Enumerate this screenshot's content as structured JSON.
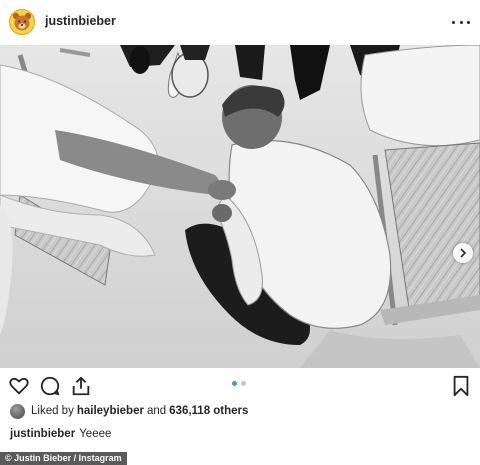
{
  "post": {
    "username": "justinbieber",
    "avatar_icon": "bear-avatar-icon"
  },
  "photo": {
    "description_icon": "photo"
  },
  "actions": {
    "like_icon": "heart-icon",
    "comment_icon": "comment-icon",
    "share_icon": "share-icon",
    "save_icon": "bookmark-icon",
    "carousel_count": 2,
    "carousel_active": 1
  },
  "likes": {
    "prefix": "Liked by",
    "user": "haileybieber",
    "connector": "and",
    "count_text": "636,118 others"
  },
  "caption": {
    "username": "justinbieber",
    "text": "Yeeee"
  },
  "credit": {
    "text": "© Justin Bieber / Instagram"
  },
  "colors": {
    "accent": "#3897f0",
    "text": "#262626"
  }
}
